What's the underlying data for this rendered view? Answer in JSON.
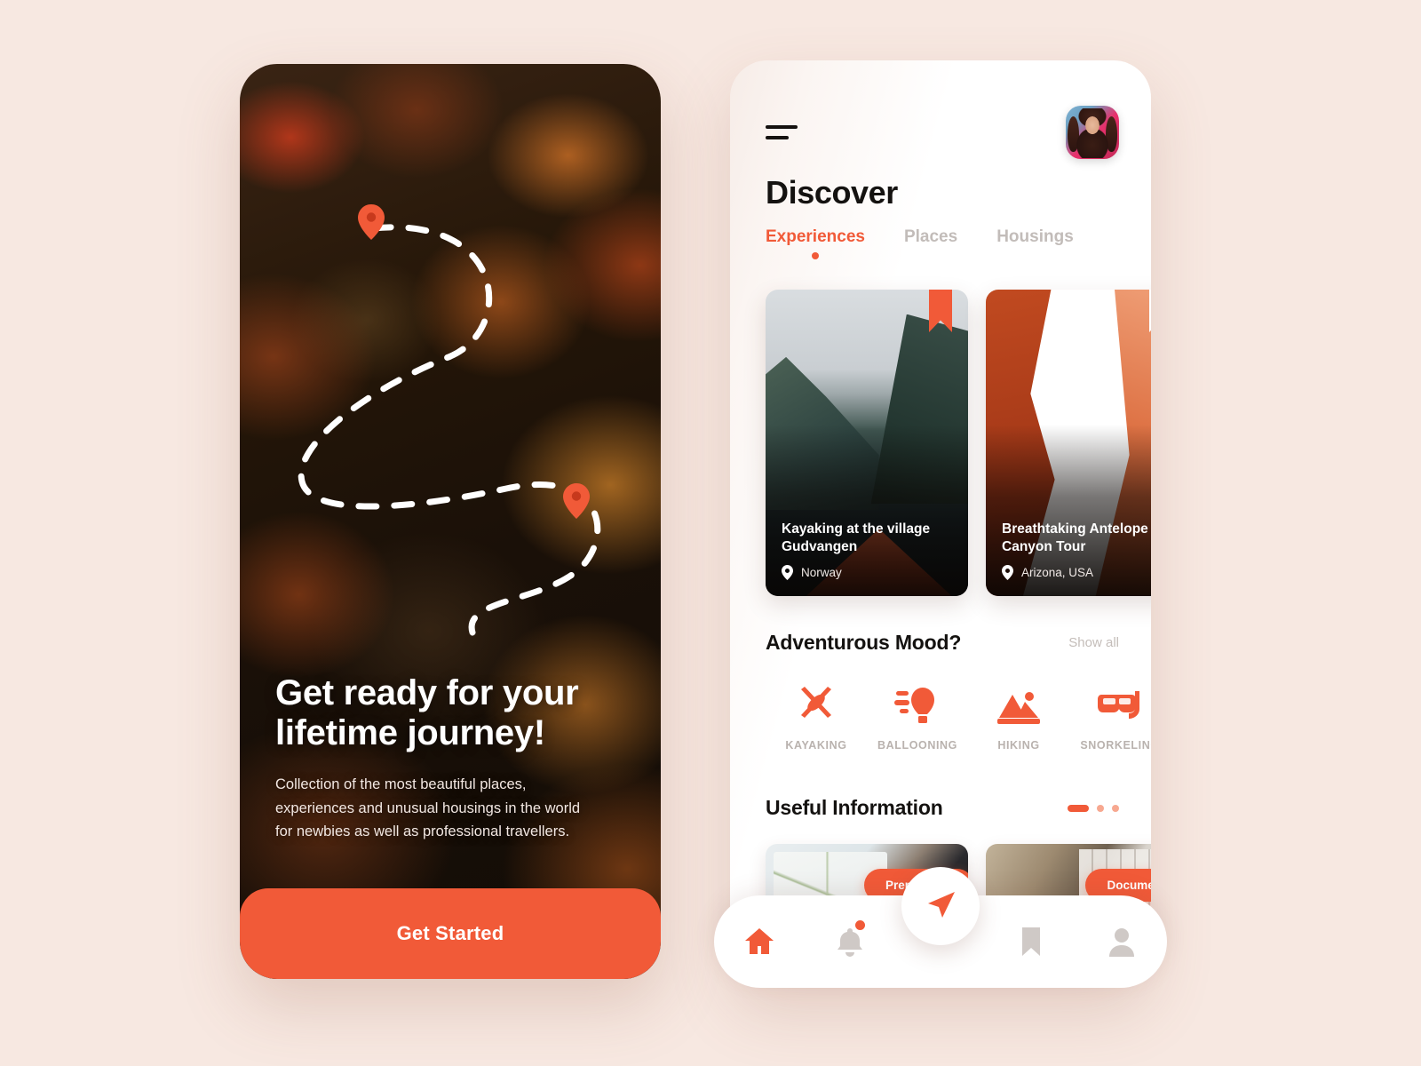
{
  "theme": {
    "accent": "#F15A38",
    "background": "#F7E8E1",
    "text_dark": "#141210",
    "text_muted": "#C2BCB9"
  },
  "onboarding": {
    "title": "Get ready for your\nlifetime journey!",
    "subtitle": "Collection of the most beautiful places,\nexperiences and unusual housings in the world\nfor newbies as well as professional travellers.",
    "cta_label": "Get Started",
    "map_pins": [
      "map-pin-start",
      "map-pin-end"
    ]
  },
  "discover": {
    "menu_icon": "hamburger-menu-icon",
    "avatar_icon": "user-avatar",
    "title": "Discover",
    "tabs": [
      {
        "label": "Experiences",
        "active": true
      },
      {
        "label": "Places",
        "active": false
      },
      {
        "label": "Housings",
        "active": false
      }
    ],
    "experience_cards": [
      {
        "title": "Kayaking at the village Gudvangen",
        "location": "Norway",
        "bookmark": "saved",
        "image": "fjord-kayak-photo"
      },
      {
        "title": "Breathtaking Antelope Canyon Tour",
        "location": "Arizona, USA",
        "bookmark": "unsaved",
        "image": "antelope-canyon-photo"
      }
    ],
    "mood": {
      "title": "Adventurous Mood?",
      "show_all_label": "Show all",
      "items": [
        {
          "label": "KAYAKING",
          "icon": "kayak-icon"
        },
        {
          "label": "BALLOONING",
          "icon": "hot-air-balloon-icon"
        },
        {
          "label": "HIKING",
          "icon": "mountains-icon"
        },
        {
          "label": "SNORKELING",
          "icon": "snorkel-mask-icon"
        }
      ]
    },
    "info": {
      "title": "Useful Information",
      "pagination": {
        "total": 3,
        "active": 1
      },
      "cards": [
        {
          "pill": "Preparation",
          "image": "map-compass-backpack-photo"
        },
        {
          "pill": "Documents",
          "image": "desk-documents-photo"
        }
      ]
    },
    "bottom_nav": [
      {
        "icon": "home-icon",
        "active": true,
        "badge": false
      },
      {
        "icon": "bell-icon",
        "active": false,
        "badge": true
      },
      {
        "icon": "navigate-arrow-icon",
        "active": false,
        "badge": false
      },
      {
        "icon": "bookmark-icon",
        "active": false,
        "badge": false
      },
      {
        "icon": "person-icon",
        "active": false,
        "badge": false
      }
    ]
  }
}
